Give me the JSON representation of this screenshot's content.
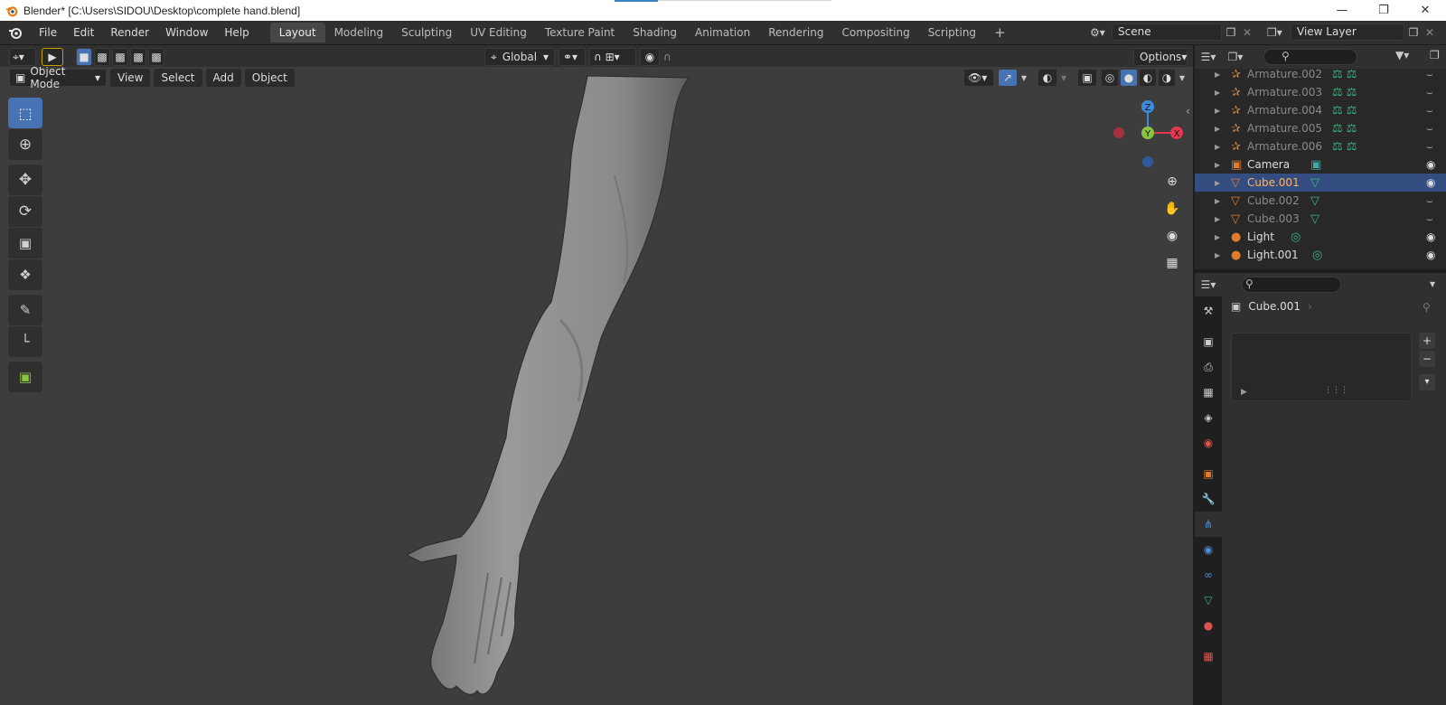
{
  "window": {
    "title": "Blender* [C:\\Users\\SIDOU\\Desktop\\complete hand.blend]",
    "controls": [
      "minimize-icon",
      "restore-icon",
      "close-icon"
    ]
  },
  "topbar": {
    "menus": [
      "File",
      "Edit",
      "Render",
      "Window",
      "Help"
    ],
    "workspaces": [
      "Layout",
      "Modeling",
      "Sculpting",
      "UV Editing",
      "Texture Paint",
      "Shading",
      "Animation",
      "Rendering",
      "Compositing",
      "Scripting"
    ],
    "active_workspace": "Layout",
    "add_workspace": "+",
    "scene_value": "Scene",
    "view_layer_value": "View Layer"
  },
  "viewport_header": {
    "transform_orientation": "Global",
    "options_label": "Options",
    "mode": "Object Mode",
    "menus": [
      "View",
      "Select",
      "Add",
      "Object"
    ]
  },
  "gizmo": {
    "z_label": "Z",
    "y_label": "Y",
    "x_label": "X",
    "colors": {
      "x": "#e3384f",
      "y": "#8bc53f",
      "z": "#3d8ae0",
      "neg_x": "#a5303f",
      "neg_z": "#2f5a9a"
    }
  },
  "outliner": {
    "search_placeholder": "",
    "rows": [
      {
        "name": "Armature.002",
        "type": "armature",
        "dim": true,
        "visible": false
      },
      {
        "name": "Armature.003",
        "type": "armature",
        "dim": true,
        "visible": false
      },
      {
        "name": "Armature.004",
        "type": "armature",
        "dim": true,
        "visible": false
      },
      {
        "name": "Armature.005",
        "type": "armature",
        "dim": true,
        "visible": false
      },
      {
        "name": "Armature.006",
        "type": "armature",
        "dim": true,
        "visible": false
      },
      {
        "name": "Camera",
        "type": "camera",
        "dim": false,
        "visible": true
      },
      {
        "name": "Cube.001",
        "type": "mesh",
        "dim": false,
        "visible": true,
        "selected": true
      },
      {
        "name": "Cube.002",
        "type": "mesh",
        "dim": true,
        "visible": false
      },
      {
        "name": "Cube.003",
        "type": "mesh",
        "dim": true,
        "visible": false
      },
      {
        "name": "Light",
        "type": "light",
        "dim": false,
        "visible": true
      },
      {
        "name": "Light.001",
        "type": "light",
        "dim": false,
        "visible": true
      }
    ]
  },
  "properties": {
    "search_placeholder": "",
    "object_name": "Cube.001",
    "add_label": "+",
    "remove_label": "−",
    "tabs": [
      "tool",
      "render",
      "output",
      "view-layer",
      "scene",
      "world",
      "object",
      "modifier",
      "particles",
      "physics",
      "constraints",
      "data",
      "material",
      "texture"
    ],
    "active_tab": "particles"
  },
  "colors": {
    "accent": "#4772b3",
    "selected_row": "#334d80",
    "orange": "#e07a2f",
    "green": "#3fb37f",
    "teal": "#41a8a0"
  }
}
